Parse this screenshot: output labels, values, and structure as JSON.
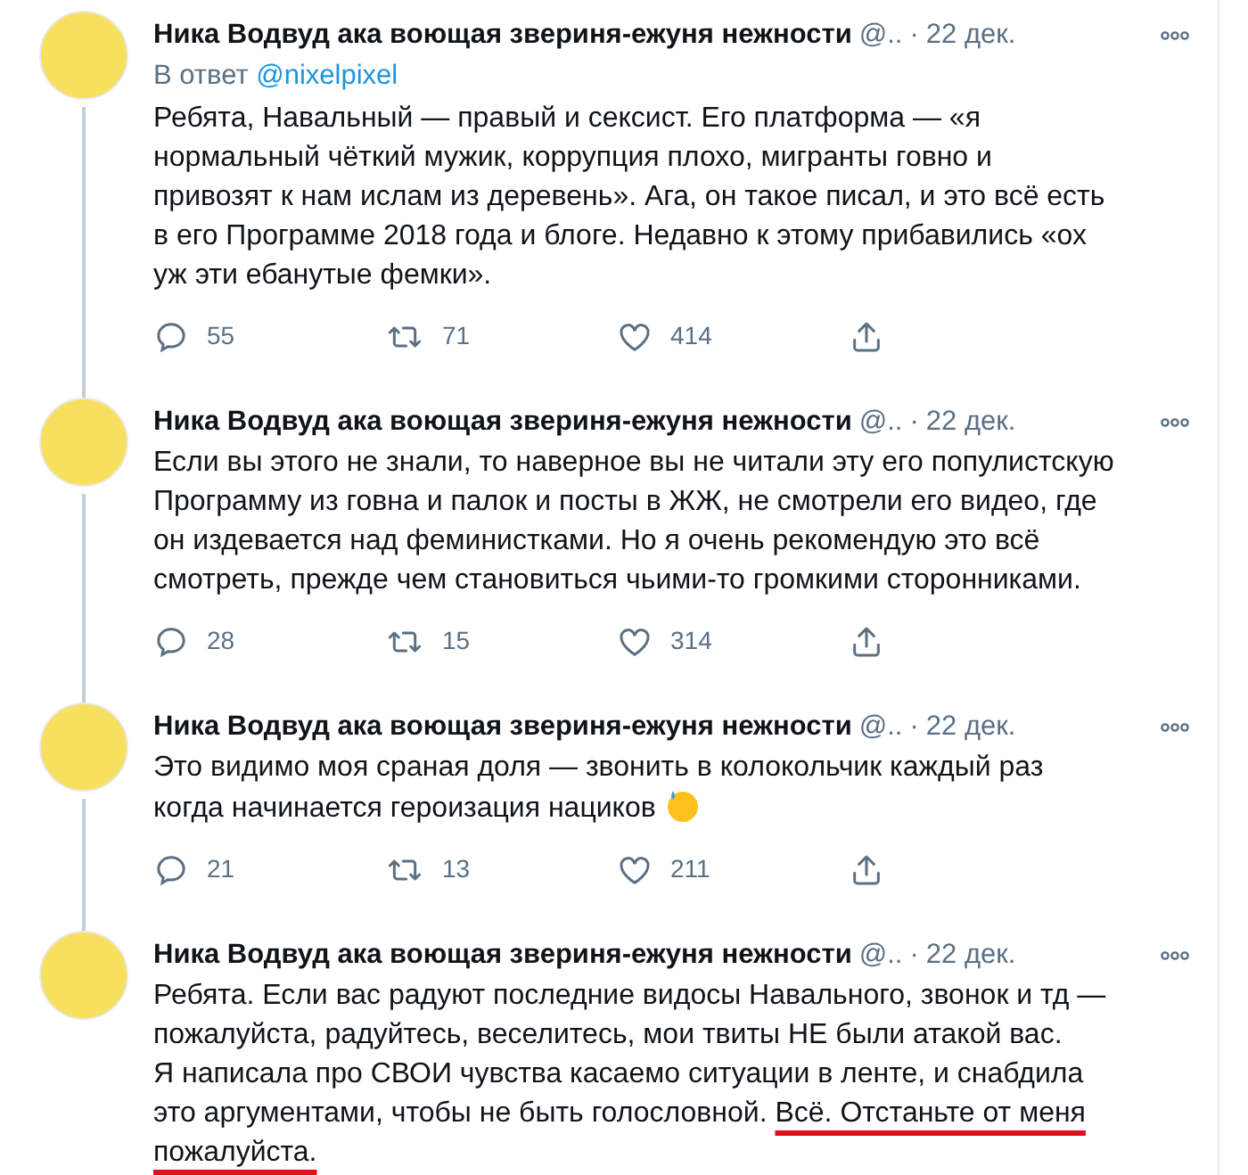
{
  "tweets": [
    {
      "author": "Ника Водвуд ака воющая звериня-ежуня нежности",
      "handle": "@..",
      "separator": "·",
      "date": "22 дек.",
      "reply_to_label": "В ответ",
      "reply_to": "@nixelpixel",
      "text": [
        {
          "text": "Ребята, Навальный — правый и сексист. Его платформа — «я нормальный чёткий мужик, коррупция плохо, мигранты говно и привозят к нам ислам из деревень». Ага, он такое писал, и это всё есть в его Программе 2018 года и блоге. Недавно к этому прибавились «ох уж эти ебанутые фемки».",
          "underlined": false
        }
      ],
      "replies": "55",
      "retweets": "71",
      "likes": "414"
    },
    {
      "author": "Ника Водвуд ака воющая звериня-ежуня нежности",
      "handle": "@..",
      "separator": "·",
      "date": "22 дек.",
      "text": [
        {
          "text": "Если вы этого не знали, то наверное вы не читали эту его популистскую Программу из говна и палок и посты в ЖЖ, не смотрели его видео, где он издевается над феминистками. Но я очень рекомендую это всё смотреть, прежде чем становиться чьими-то громкими сторонниками.",
          "underlined": false
        }
      ],
      "replies": "28",
      "retweets": "15",
      "likes": "314"
    },
    {
      "author": "Ника Водвуд ака воющая звериня-ежуня нежности",
      "handle": "@..",
      "separator": "·",
      "date": "22 дек.",
      "text": [
        {
          "text": "Это видимо моя сраная доля — звонить в колокольчик каждый раз когда начинается героизация нациков",
          "underlined": false
        }
      ],
      "sweat_emoji": true,
      "replies": "21",
      "retweets": "13",
      "likes": "211"
    },
    {
      "author": "Ника Водвуд ака воющая звериня-ежуня нежности",
      "handle": "@..",
      "separator": "·",
      "date": "22 дек.",
      "text": [
        {
          "text": "Ребята. Если вас радуют последние видосы Навального, звонок и тд — пожалуйста, радуйтесь, веселитесь, мои твиты НЕ были атакой вас.\nЯ написала про СВОИ чувства касаемо ситуации в ленте, и снабдила это аргументами, чтобы не быть голословной. ",
          "underlined": false
        },
        {
          "text": "Всё. Отстаньте от меня пожалуйста.",
          "underlined": true
        }
      ]
    }
  ]
}
